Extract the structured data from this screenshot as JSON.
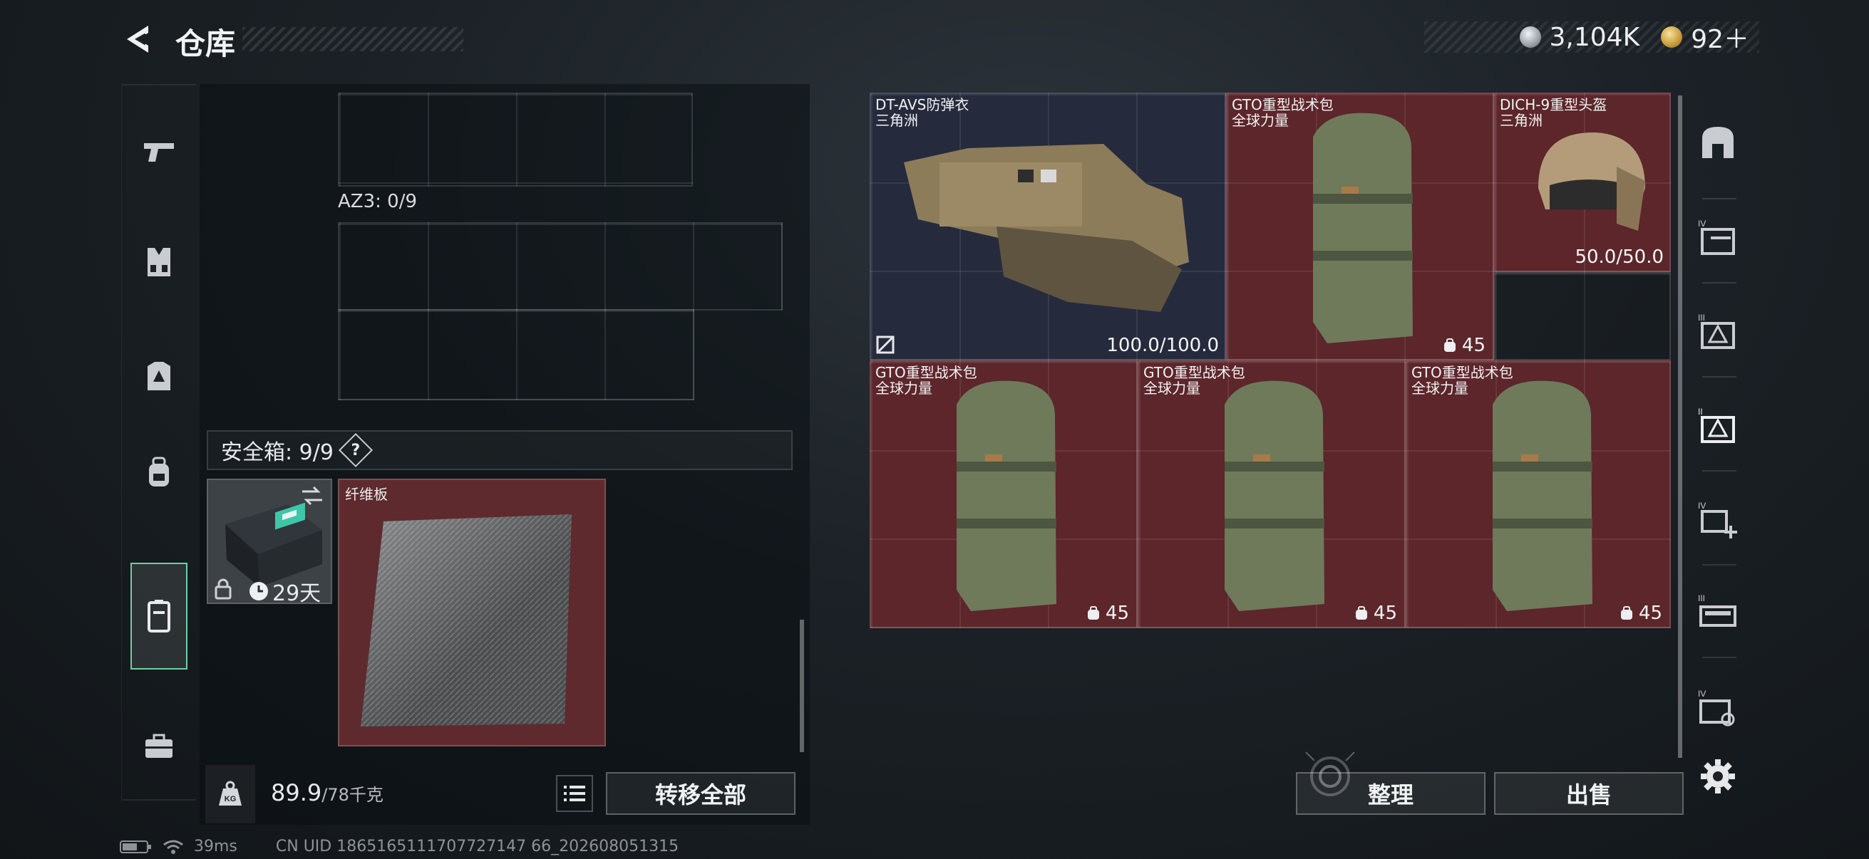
{
  "header": {
    "title": "仓库",
    "currencies": [
      {
        "icon": "silver-coin-icon",
        "value": "3,104K"
      },
      {
        "icon": "gold-coin-icon",
        "value": "92＋"
      }
    ]
  },
  "left_rail": {
    "tabs": [
      {
        "icon": "pistol-icon",
        "active": false
      },
      {
        "icon": "vest-icon",
        "active": false
      },
      {
        "icon": "armor-plate-icon",
        "active": false
      },
      {
        "icon": "backpack-icon",
        "active": false
      },
      {
        "icon": "safe-case-icon",
        "active": true
      },
      {
        "icon": "briefcase-icon",
        "active": false
      }
    ]
  },
  "storage": {
    "az_label": "AZ3: 0/9",
    "safe_box_label": "安全箱: 9/9",
    "help_symbol": "?",
    "safe_case": {
      "duration": "29天",
      "swap_icon": "swap-icon",
      "lock_icon": "lock-icon",
      "clock_icon": "clock-icon"
    },
    "fiber_item": {
      "name": "纤维板"
    }
  },
  "bottom_left": {
    "weight_value": "89.9",
    "weight_unit": "/78千克",
    "transfer_all": "转移全部"
  },
  "loot": {
    "items": [
      {
        "name": "DT-AVS防弹衣",
        "sub": "三角洲",
        "durability": "100.0/100.0",
        "color": "navy"
      },
      {
        "name": "GTO重型战术包",
        "sub": "全球力量",
        "capacity": "45",
        "color": "red"
      },
      {
        "name": "DICH-9重型头盔",
        "sub": "三角洲",
        "durability": "50.0/50.0",
        "color": "red"
      },
      {
        "name": "GTO重型战术包",
        "sub": "全球力量",
        "capacity": "45",
        "color": "red"
      },
      {
        "name": "GTO重型战术包",
        "sub": "全球力量",
        "capacity": "45",
        "color": "red"
      },
      {
        "name": "GTO重型战术包",
        "sub": "全球力量",
        "capacity": "45",
        "color": "red"
      }
    ]
  },
  "right_rail": {
    "tabs": [
      "shield-icon",
      "tier-iv-case-icon",
      "tier-iii-case-icon",
      "tier-ii-case-icon",
      "tier-iv-plus-icon",
      "tier-iii-box-icon",
      "tier-iv-gear-icon"
    ]
  },
  "actions": {
    "organize": "整理",
    "sell": "出售"
  },
  "status": {
    "ping": "39ms",
    "uid": "CN UID 1865165111707727147 66_202608051315"
  },
  "colors": {
    "accent_green": "#6fcf9f",
    "slot_red": "#5c262b",
    "slot_navy": "#262a3d"
  }
}
